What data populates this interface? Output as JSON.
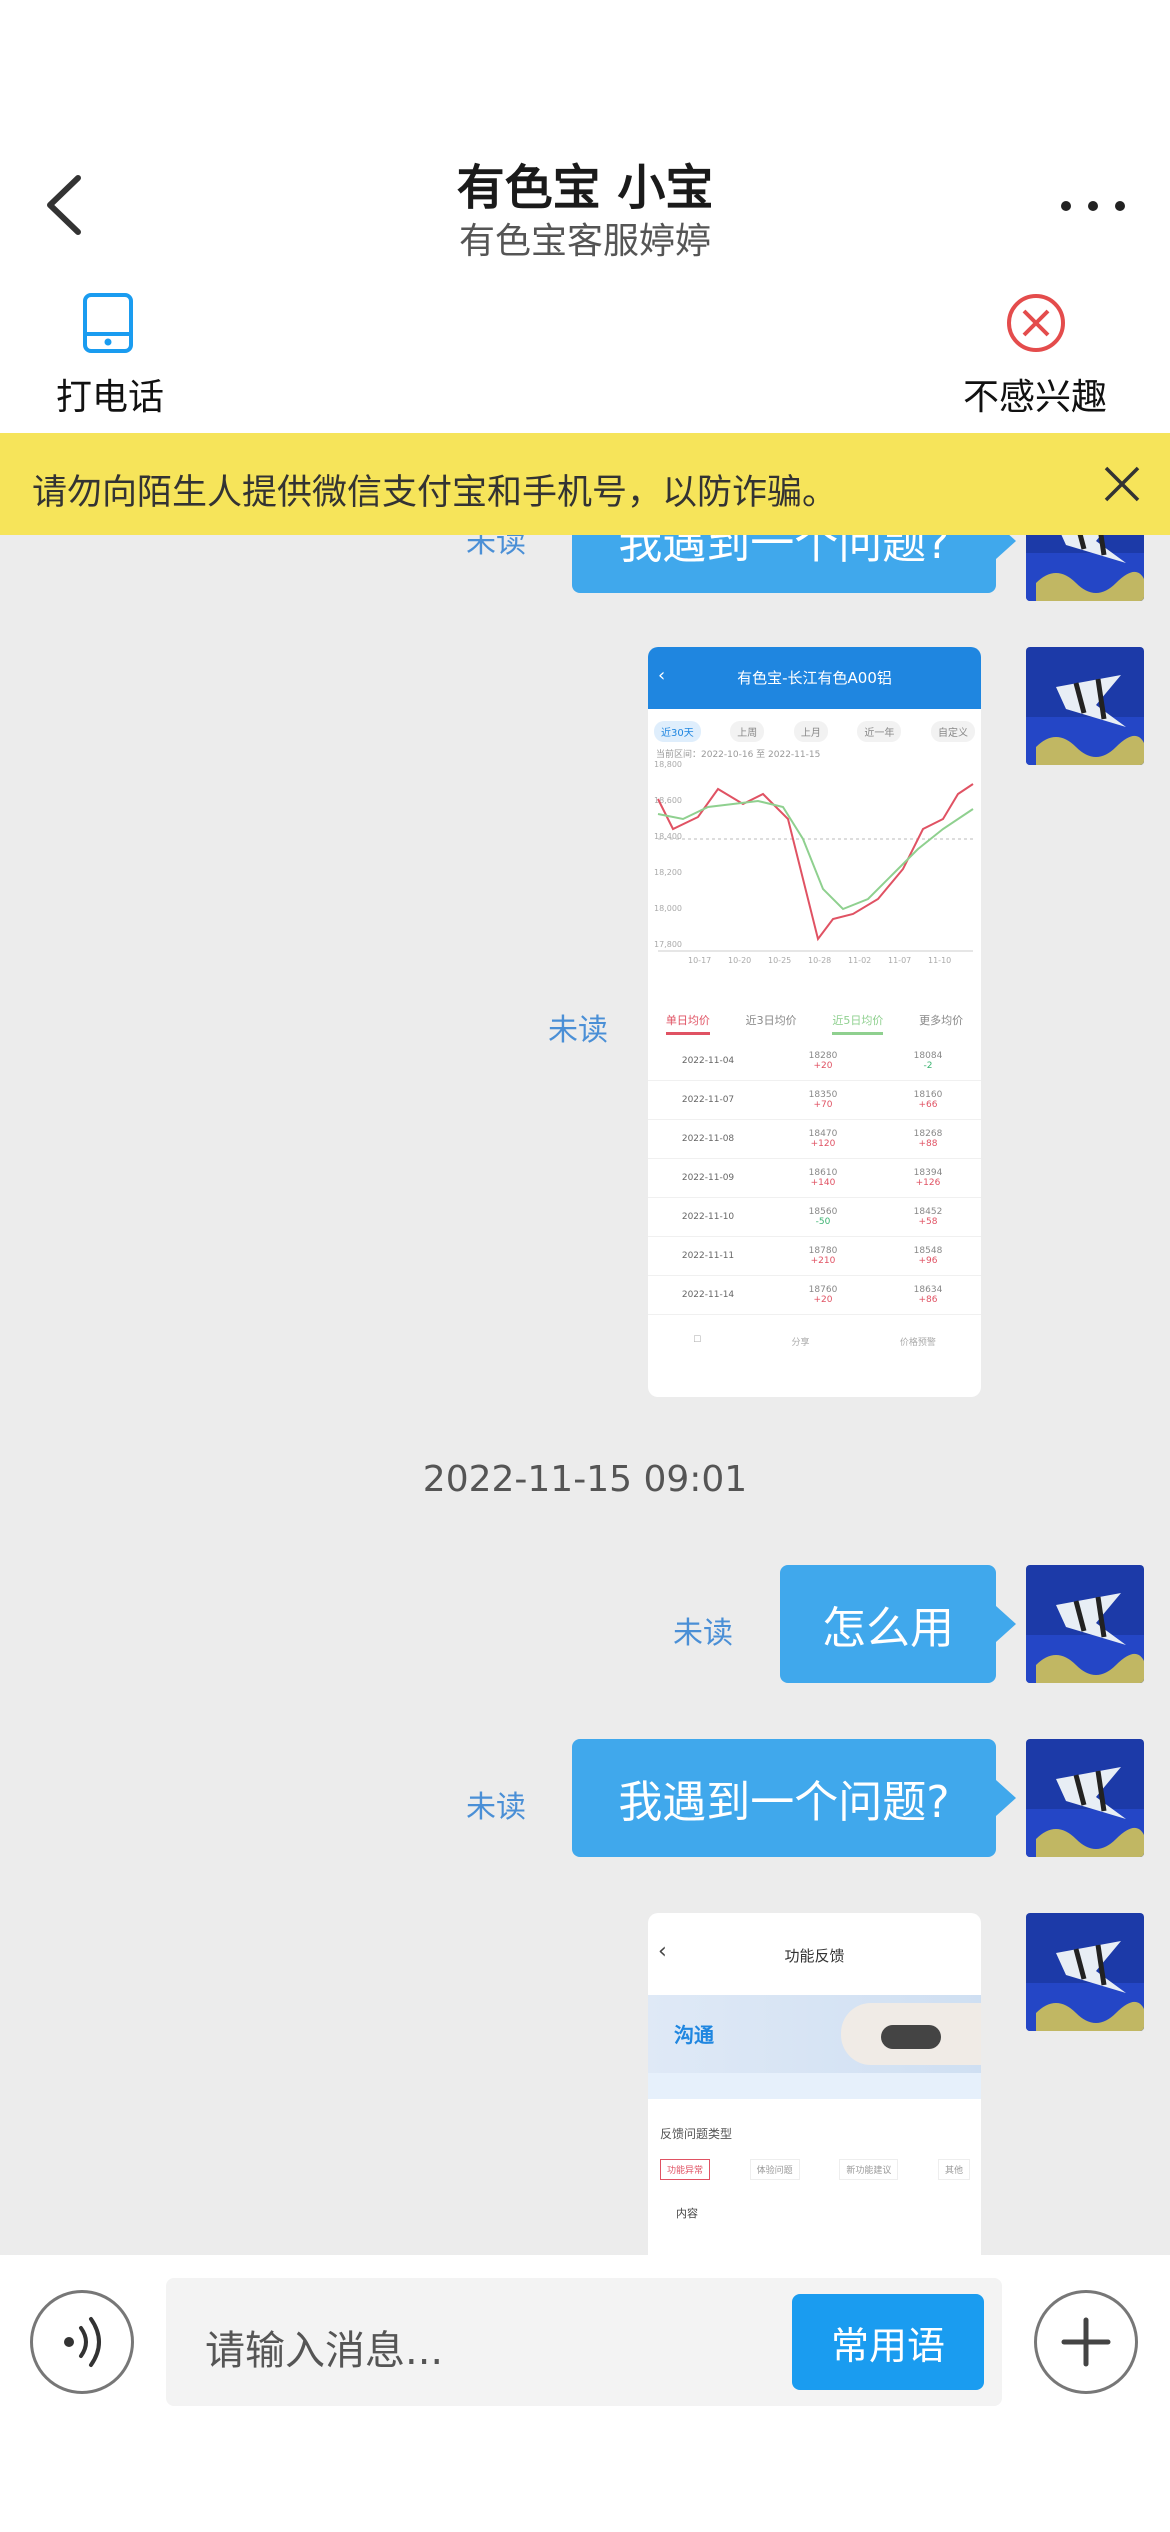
{
  "header": {
    "title": "有色宝 小宝",
    "subtitle": "有色宝客服婷婷",
    "call_label": "打电话",
    "not_interested_label": "不感兴趣"
  },
  "banner": {
    "text": "请勿向陌生人提供微信支付宝和手机号，以防诈骗。"
  },
  "messages": {
    "m1": {
      "text": "我遇到一个问题?",
      "status": "未读"
    },
    "m2": {
      "status": "未读"
    },
    "timestamp": "2022-11-15 09:01",
    "m3": {
      "text": "怎么用",
      "status": "未读"
    },
    "m4": {
      "text": "我遇到一个问题?",
      "status": "未读"
    }
  },
  "screenshot1": {
    "title": "有色宝-长江有色A00铝",
    "tabs": [
      "近30天",
      "上周",
      "上月",
      "近一年",
      "自定义"
    ],
    "range_text": "当前区间：2022-10-16 至 2022-11-15",
    "y_ticks": [
      "18,800",
      "18,600",
      "18,400",
      "18,200",
      "18,000",
      "17,800"
    ],
    "x_ticks": [
      "10-17",
      "10-20",
      "10-25",
      "10-28",
      "11-02",
      "11-07",
      "11-10"
    ],
    "bottom_tabs": [
      "单日均价",
      "近3日均价",
      "近5日均价",
      "更多均价"
    ],
    "rows": [
      {
        "date": "2022-11-04",
        "v1": "18280",
        "c1": "+20",
        "v2": "18084",
        "c2": "-2"
      },
      {
        "date": "2022-11-07",
        "v1": "18350",
        "c1": "+70",
        "v2": "18160",
        "c2": "+66"
      },
      {
        "date": "2022-11-08",
        "v1": "18470",
        "c1": "+120",
        "v2": "18268",
        "c2": "+88"
      },
      {
        "date": "2022-11-09",
        "v1": "18610",
        "c1": "+140",
        "v2": "18394",
        "c2": "+126"
      },
      {
        "date": "2022-11-10",
        "v1": "18560",
        "c1": "-50",
        "v2": "18452",
        "c2": "+58"
      },
      {
        "date": "2022-11-11",
        "v1": "18780",
        "c1": "+210",
        "v2": "18548",
        "c2": "+96"
      },
      {
        "date": "2022-11-14",
        "v1": "18760",
        "c1": "+20",
        "v2": "18634",
        "c2": "+86"
      }
    ],
    "footer": [
      "分享",
      "价格预警"
    ],
    "line_colors": {
      "red": "#e05263",
      "green": "#8fd08f"
    }
  },
  "screenshot2": {
    "title": "功能反馈",
    "hero_text": "沟通",
    "section_label": "反馈问题类型",
    "chips": [
      "功能异常",
      "体验问题",
      "新功能建议",
      "其他"
    ],
    "content_label": "内容"
  },
  "input": {
    "placeholder": "请输入消息...",
    "phrases_button": "常用语"
  }
}
